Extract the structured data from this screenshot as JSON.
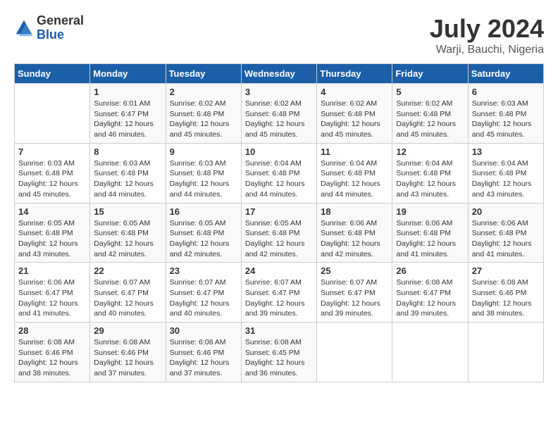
{
  "logo": {
    "general": "General",
    "blue": "Blue"
  },
  "header": {
    "month": "July 2024",
    "location": "Warji, Bauchi, Nigeria"
  },
  "weekdays": [
    "Sunday",
    "Monday",
    "Tuesday",
    "Wednesday",
    "Thursday",
    "Friday",
    "Saturday"
  ],
  "weeks": [
    [
      {
        "day": "",
        "info": ""
      },
      {
        "day": "1",
        "info": "Sunrise: 6:01 AM\nSunset: 6:47 PM\nDaylight: 12 hours\nand 46 minutes."
      },
      {
        "day": "2",
        "info": "Sunrise: 6:02 AM\nSunset: 6:48 PM\nDaylight: 12 hours\nand 45 minutes."
      },
      {
        "day": "3",
        "info": "Sunrise: 6:02 AM\nSunset: 6:48 PM\nDaylight: 12 hours\nand 45 minutes."
      },
      {
        "day": "4",
        "info": "Sunrise: 6:02 AM\nSunset: 6:48 PM\nDaylight: 12 hours\nand 45 minutes."
      },
      {
        "day": "5",
        "info": "Sunrise: 6:02 AM\nSunset: 6:48 PM\nDaylight: 12 hours\nand 45 minutes."
      },
      {
        "day": "6",
        "info": "Sunrise: 6:03 AM\nSunset: 6:48 PM\nDaylight: 12 hours\nand 45 minutes."
      }
    ],
    [
      {
        "day": "7",
        "info": "Sunrise: 6:03 AM\nSunset: 6:48 PM\nDaylight: 12 hours\nand 45 minutes."
      },
      {
        "day": "8",
        "info": "Sunrise: 6:03 AM\nSunset: 6:48 PM\nDaylight: 12 hours\nand 44 minutes."
      },
      {
        "day": "9",
        "info": "Sunrise: 6:03 AM\nSunset: 6:48 PM\nDaylight: 12 hours\nand 44 minutes."
      },
      {
        "day": "10",
        "info": "Sunrise: 6:04 AM\nSunset: 6:48 PM\nDaylight: 12 hours\nand 44 minutes."
      },
      {
        "day": "11",
        "info": "Sunrise: 6:04 AM\nSunset: 6:48 PM\nDaylight: 12 hours\nand 44 minutes."
      },
      {
        "day": "12",
        "info": "Sunrise: 6:04 AM\nSunset: 6:48 PM\nDaylight: 12 hours\nand 43 minutes."
      },
      {
        "day": "13",
        "info": "Sunrise: 6:04 AM\nSunset: 6:48 PM\nDaylight: 12 hours\nand 43 minutes."
      }
    ],
    [
      {
        "day": "14",
        "info": "Sunrise: 6:05 AM\nSunset: 6:48 PM\nDaylight: 12 hours\nand 43 minutes."
      },
      {
        "day": "15",
        "info": "Sunrise: 6:05 AM\nSunset: 6:48 PM\nDaylight: 12 hours\nand 42 minutes."
      },
      {
        "day": "16",
        "info": "Sunrise: 6:05 AM\nSunset: 6:48 PM\nDaylight: 12 hours\nand 42 minutes."
      },
      {
        "day": "17",
        "info": "Sunrise: 6:05 AM\nSunset: 6:48 PM\nDaylight: 12 hours\nand 42 minutes."
      },
      {
        "day": "18",
        "info": "Sunrise: 6:06 AM\nSunset: 6:48 PM\nDaylight: 12 hours\nand 42 minutes."
      },
      {
        "day": "19",
        "info": "Sunrise: 6:06 AM\nSunset: 6:48 PM\nDaylight: 12 hours\nand 41 minutes."
      },
      {
        "day": "20",
        "info": "Sunrise: 6:06 AM\nSunset: 6:48 PM\nDaylight: 12 hours\nand 41 minutes."
      }
    ],
    [
      {
        "day": "21",
        "info": "Sunrise: 6:06 AM\nSunset: 6:47 PM\nDaylight: 12 hours\nand 41 minutes."
      },
      {
        "day": "22",
        "info": "Sunrise: 6:07 AM\nSunset: 6:47 PM\nDaylight: 12 hours\nand 40 minutes."
      },
      {
        "day": "23",
        "info": "Sunrise: 6:07 AM\nSunset: 6:47 PM\nDaylight: 12 hours\nand 40 minutes."
      },
      {
        "day": "24",
        "info": "Sunrise: 6:07 AM\nSunset: 6:47 PM\nDaylight: 12 hours\nand 39 minutes."
      },
      {
        "day": "25",
        "info": "Sunrise: 6:07 AM\nSunset: 6:47 PM\nDaylight: 12 hours\nand 39 minutes."
      },
      {
        "day": "26",
        "info": "Sunrise: 6:08 AM\nSunset: 6:47 PM\nDaylight: 12 hours\nand 39 minutes."
      },
      {
        "day": "27",
        "info": "Sunrise: 6:08 AM\nSunset: 6:46 PM\nDaylight: 12 hours\nand 38 minutes."
      }
    ],
    [
      {
        "day": "28",
        "info": "Sunrise: 6:08 AM\nSunset: 6:46 PM\nDaylight: 12 hours\nand 38 minutes."
      },
      {
        "day": "29",
        "info": "Sunrise: 6:08 AM\nSunset: 6:46 PM\nDaylight: 12 hours\nand 37 minutes."
      },
      {
        "day": "30",
        "info": "Sunrise: 6:08 AM\nSunset: 6:46 PM\nDaylight: 12 hours\nand 37 minutes."
      },
      {
        "day": "31",
        "info": "Sunrise: 6:08 AM\nSunset: 6:45 PM\nDaylight: 12 hours\nand 36 minutes."
      },
      {
        "day": "",
        "info": ""
      },
      {
        "day": "",
        "info": ""
      },
      {
        "day": "",
        "info": ""
      }
    ]
  ]
}
